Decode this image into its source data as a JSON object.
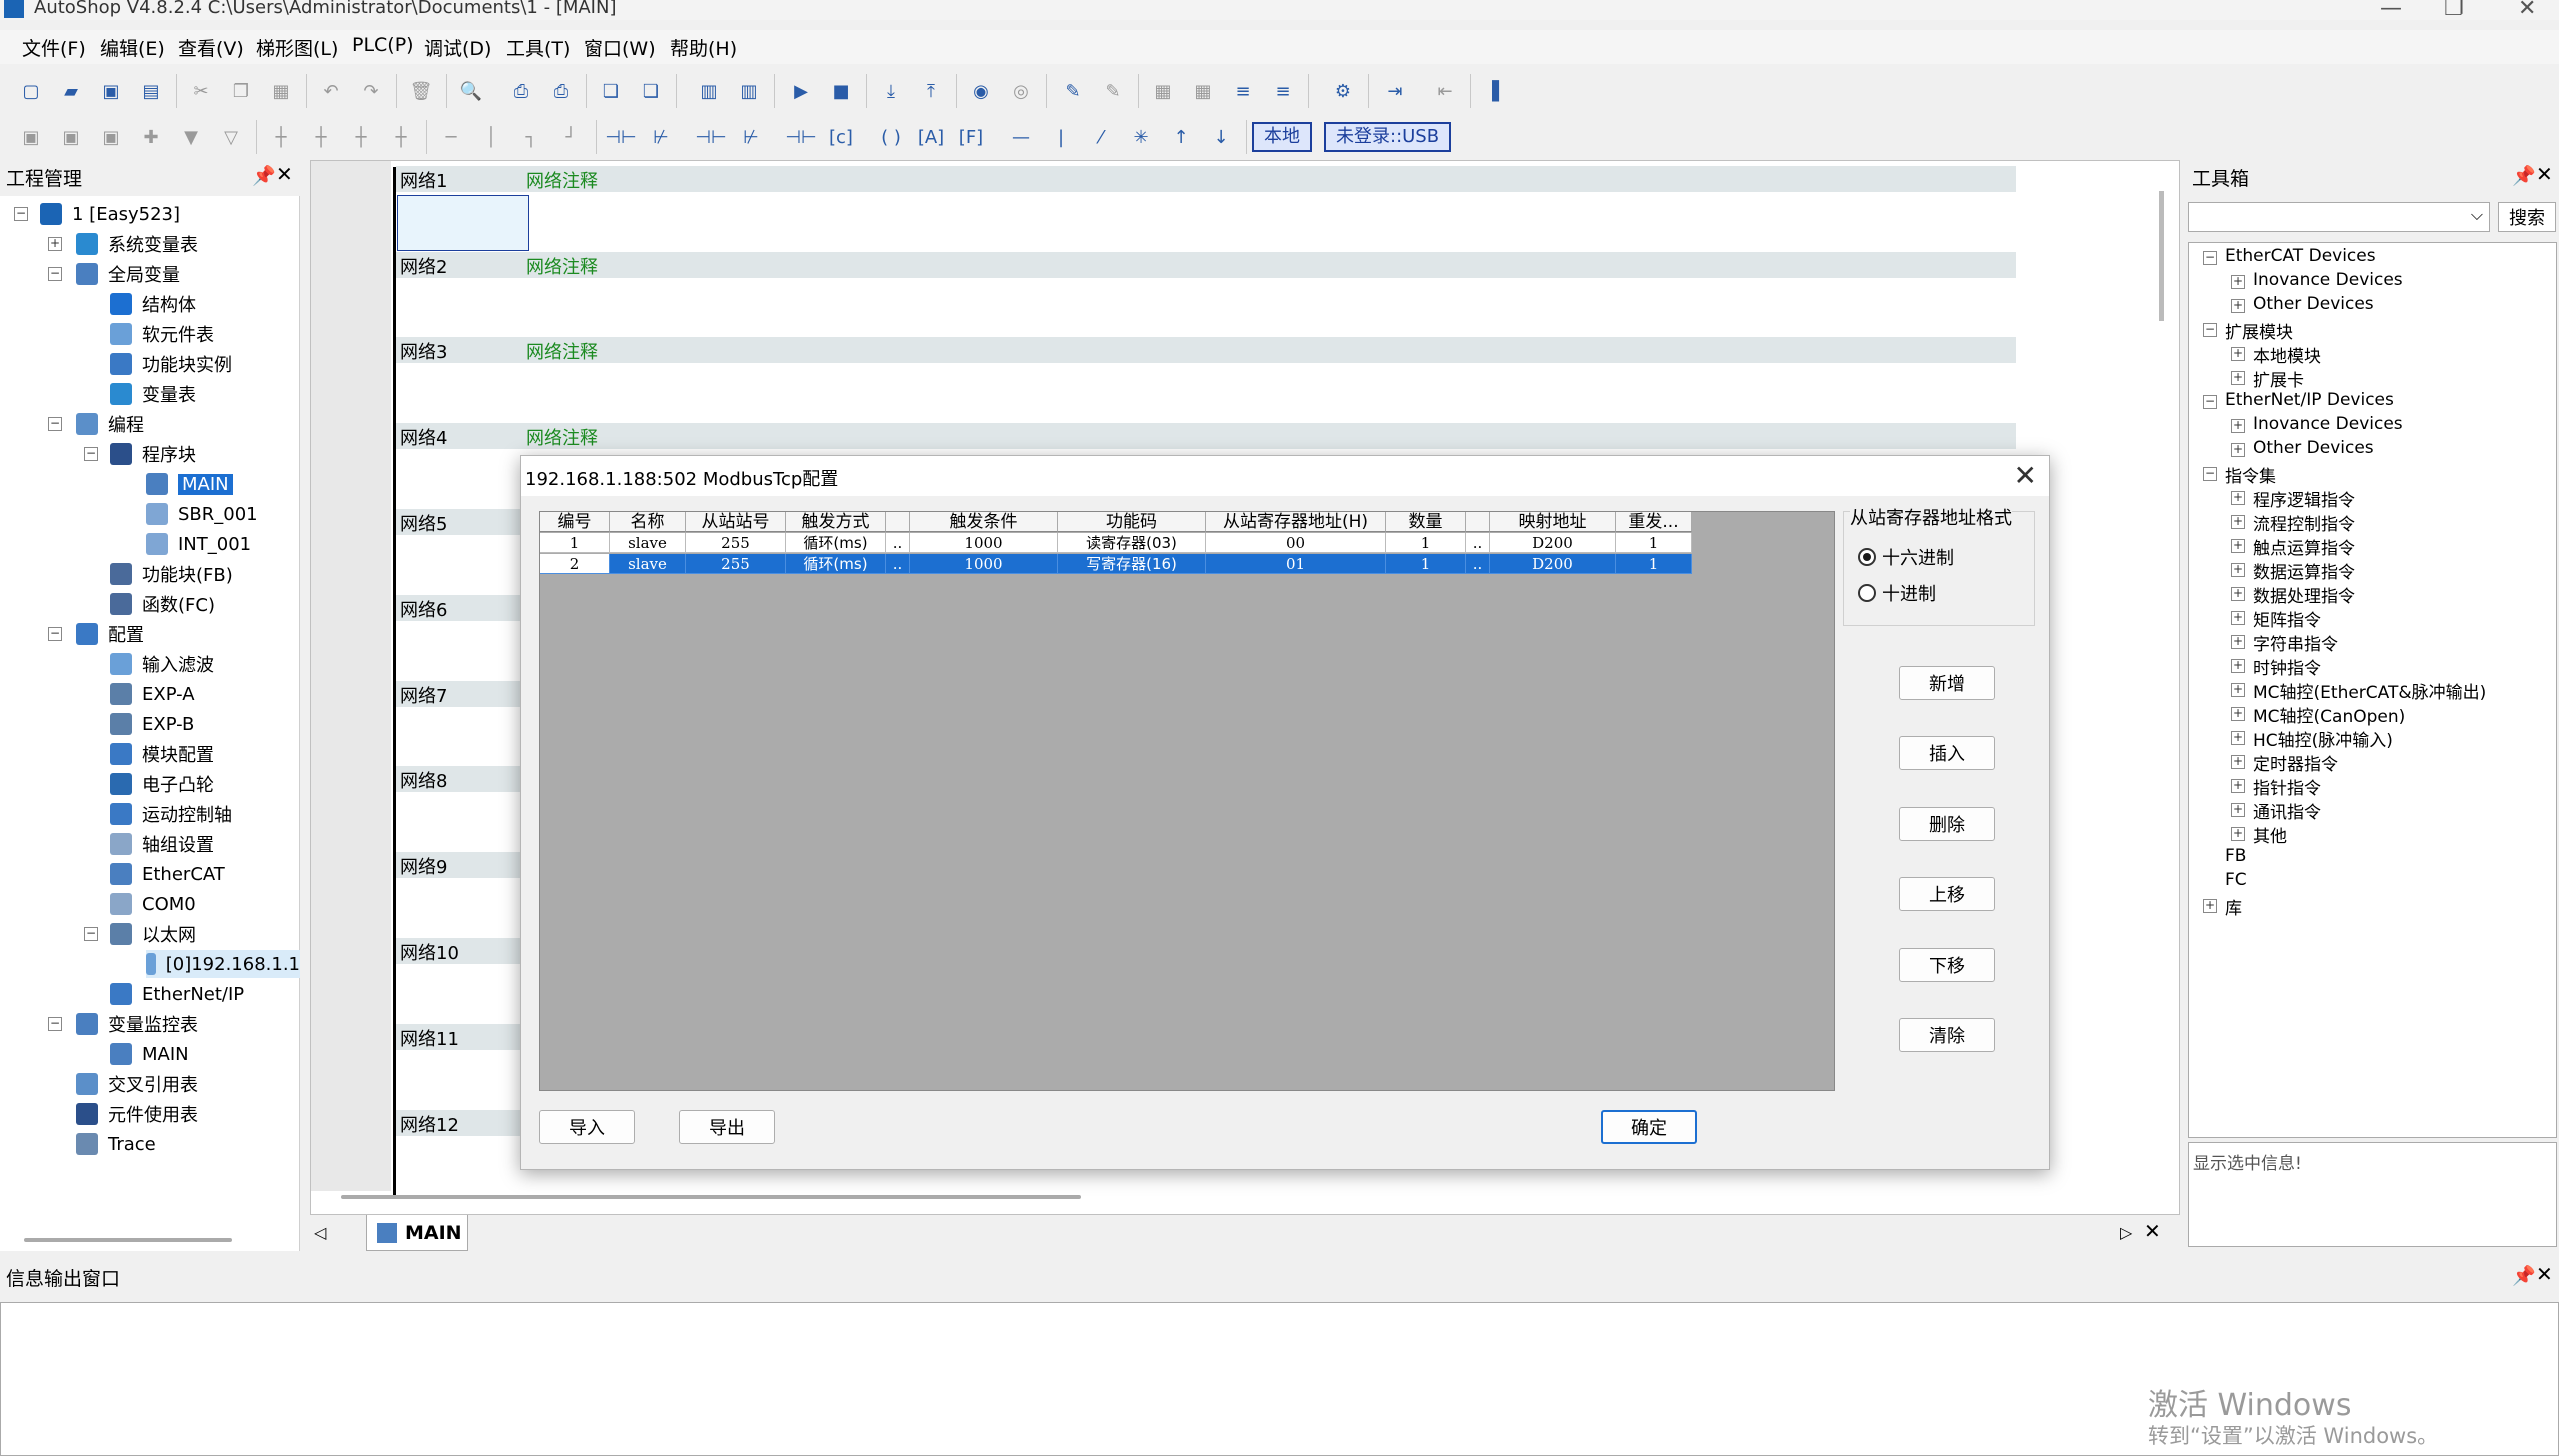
{
  "titlebar": {
    "title": "AutoShop V4.8.2.4  C:\\Users\\Administrator\\Documents\\1 - [MAIN]"
  },
  "menu": [
    "文件(F)",
    "编辑(E)",
    "查看(V)",
    "梯形图(L)",
    "PLC(P)",
    "调试(D)",
    "工具(T)",
    "窗口(W)",
    "帮助(H)"
  ],
  "toolbar2": {
    "local_label": "本地",
    "usb_label": "未登录::USB"
  },
  "project": {
    "title": "工程管理",
    "items": [
      "1 [Easy523]",
      "系统变量表",
      "全局变量",
      "结构体",
      "软元件表",
      "功能块实例",
      "变量表",
      "编程",
      "程序块",
      "MAIN",
      "SBR_001",
      "INT_001",
      "功能块(FB)",
      "函数(FC)",
      "配置",
      "输入滤波",
      "EXP-A",
      "EXP-B",
      "模块配置",
      "电子凸轮",
      "运动控制轴",
      "轴组设置",
      "EtherCAT",
      "COM0",
      "以太网",
      "[0]192.168.1.1",
      "EtherNet/IP",
      "变量监控表",
      "MAIN",
      "交叉引用表",
      "元件使用表",
      "Trace"
    ]
  },
  "editor": {
    "networks": [
      "网络1",
      "网络2",
      "网络3",
      "网络4",
      "网络5",
      "网络6",
      "网络7",
      "网络8",
      "网络9",
      "网络10",
      "网络11",
      "网络12"
    ],
    "comment": "网络注释",
    "tab": "MAIN"
  },
  "toolbox": {
    "title": "工具箱",
    "search_button": "搜索",
    "items": [
      "EtherCAT Devices",
      "Inovance Devices",
      "Other Devices",
      "扩展模块",
      "本地模块",
      "扩展卡",
      "EtherNet/IP Devices",
      "Inovance Devices",
      "Other Devices",
      "指令集",
      "程序逻辑指令",
      "流程控制指令",
      "触点运算指令",
      "数据运算指令",
      "数据处理指令",
      "矩阵指令",
      "字符串指令",
      "时钟指令",
      "MC轴控(EtherCAT&脉冲输出)",
      "MC轴控(CanOpen)",
      "HC轴控(脉冲输入)",
      "定时器指令",
      "指针指令",
      "通讯指令",
      "其他",
      "FB",
      "FC",
      "库"
    ],
    "info": "显示选中信息!"
  },
  "info_panel": {
    "title": "信息输出窗口"
  },
  "watermark": {
    "line1": "激活 Windows",
    "line2": "转到“设置”以激活 Windows。"
  },
  "dialog": {
    "title": "192.168.1.188:502 ModbusTcp配置",
    "columns": [
      "编号",
      "名称",
      "从站站号",
      "触发方式",
      "",
      "触发条件",
      "功能码",
      "从站寄存器地址(H)",
      "数量",
      "",
      "映射地址",
      "重发..."
    ],
    "rows": [
      [
        "1",
        "slave",
        "255",
        "循环(ms)",
        "..",
        "1000",
        "读寄存器(03)",
        "00",
        "1",
        "..",
        "D200",
        "1"
      ],
      [
        "2",
        "slave",
        "255",
        "循环(ms)",
        "..",
        "1000",
        "写寄存器(16)",
        "01",
        "1",
        "..",
        "D200",
        "1"
      ]
    ],
    "format_group": "从站寄存器地址格式",
    "radio_hex": "十六进制",
    "radio_dec": "十进制",
    "buttons": [
      "新增",
      "插入",
      "删除",
      "上移",
      "下移",
      "清除"
    ],
    "import": "导入",
    "export": "导出",
    "ok": "确定"
  },
  "colors": {
    "accent": "#1c6fd1",
    "comment_green": "#1b8a20",
    "selection": "#1c6fd1"
  }
}
